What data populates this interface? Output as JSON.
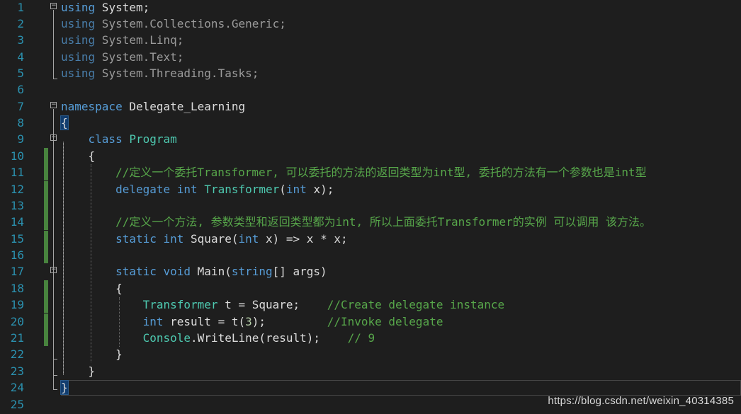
{
  "editor": {
    "language": "csharp",
    "colors": {
      "background": "#1e1e1e",
      "keyword": "#569cd6",
      "type": "#4ec9b0",
      "comment": "#57a64a",
      "line_number": "#2b91af",
      "text": "#dcdcdc"
    },
    "line_numbers": [
      "1",
      "2",
      "3",
      "4",
      "5",
      "6",
      "7",
      "8",
      "9",
      "10",
      "11",
      "12",
      "13",
      "14",
      "15",
      "16",
      "17",
      "18",
      "19",
      "20",
      "21",
      "22",
      "23",
      "24",
      "25"
    ],
    "lines": {
      "l1": [
        "using",
        " System;"
      ],
      "l2": [
        "using",
        " System.Collections.Generic;"
      ],
      "l3": [
        "using",
        " System.Linq;"
      ],
      "l4": [
        "using",
        " System.Text;"
      ],
      "l5": [
        "using",
        " System.Threading.Tasks;"
      ],
      "l7": [
        "namespace",
        " Delegate_Learning"
      ],
      "l8": [
        "{"
      ],
      "l9": [
        "    ",
        "class",
        " ",
        "Program"
      ],
      "l10": [
        "    {"
      ],
      "l11": [
        "        ",
        "//定义一个委托Transformer, 可以委托的方法的返回类型为int型, 委托的方法有一个参数也是int型"
      ],
      "l12": [
        "        ",
        "delegate",
        " ",
        "int",
        " ",
        "Transformer",
        "(",
        "int",
        " x);"
      ],
      "l14": [
        "        ",
        "//定义一个方法, 参数类型和返回类型都为int, 所以上面委托Transformer的实例 可以调用 该方法。"
      ],
      "l15": [
        "        ",
        "static",
        " ",
        "int",
        " Square(",
        "int",
        " x) => x * x;"
      ],
      "l17": [
        "        ",
        "static",
        " ",
        "void",
        " Main(",
        "string",
        "[] args)"
      ],
      "l18": [
        "        {"
      ],
      "l19": [
        "            ",
        "Transformer",
        " t = Square;    ",
        "//Create delegate instance"
      ],
      "l20": [
        "            ",
        "int",
        " result = t(",
        "3",
        ");         ",
        "//Invoke delegate"
      ],
      "l21": [
        "            ",
        "Console",
        ".WriteLine(result);    ",
        "// 9"
      ],
      "l22": [
        "        }"
      ],
      "l23": [
        "    }"
      ],
      "l24": [
        "}"
      ]
    },
    "fold_markers": [
      "⊟",
      "⊟",
      "⊟",
      "⊟"
    ]
  },
  "watermark": "https://blog.csdn.net/weixin_40314385"
}
